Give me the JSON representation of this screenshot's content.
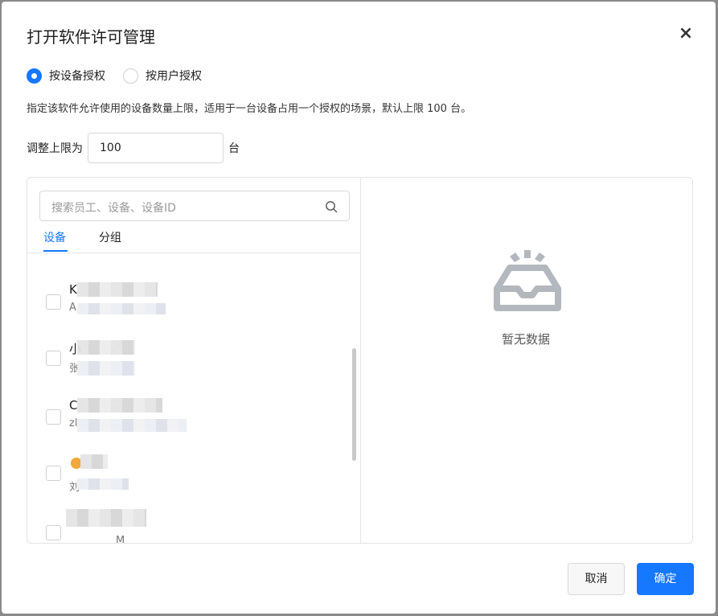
{
  "dialog": {
    "title": "打开软件许可管理",
    "close_label": "×"
  },
  "auth_mode": {
    "options": [
      {
        "label": "按设备授权",
        "checked": true
      },
      {
        "label": "按用户授权",
        "checked": false
      }
    ]
  },
  "description": "指定该软件允许使用的设备数量上限，适用于一台设备占用一个授权的场景，默认上限 100 台。",
  "limit": {
    "label_before": "调整上限为",
    "value": "100",
    "label_after": "台"
  },
  "search": {
    "placeholder": "搜索员工、设备、设备ID",
    "icon": "search-icon"
  },
  "tabs": [
    {
      "label": "设备",
      "active": true
    },
    {
      "label": "分组",
      "active": false
    }
  ],
  "devices": [
    {
      "name": "K",
      "sub": "A"
    },
    {
      "name": "小",
      "sub": "张"
    },
    {
      "name": "C",
      "sub": "zl"
    },
    {
      "name": "",
      "sub": "刘"
    },
    {
      "name": "",
      "sub": "M"
    }
  ],
  "selected_panel": {
    "empty_text": "暂无数据",
    "icon": "empty-inbox-icon"
  },
  "footer": {
    "cancel_label": "取消",
    "ok_label": "确定"
  },
  "colors": {
    "accent": "#1677ff"
  }
}
